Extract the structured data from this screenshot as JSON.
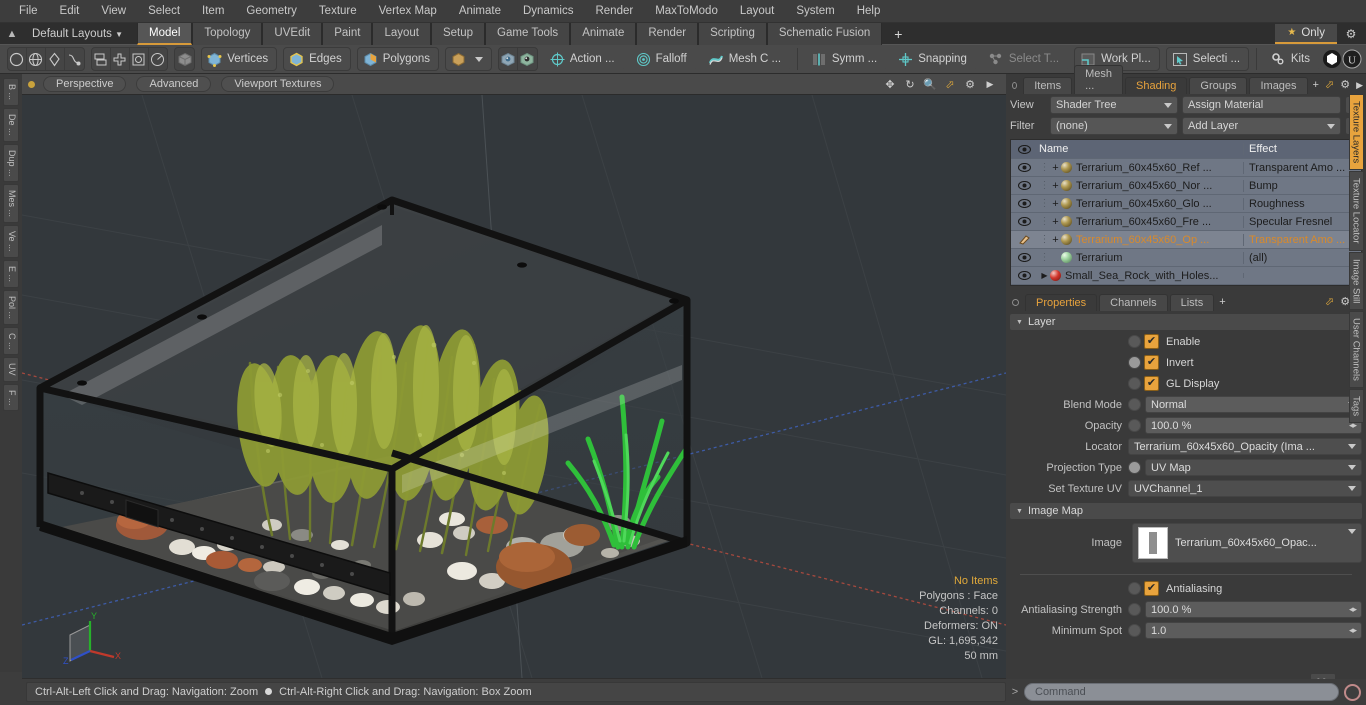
{
  "menubar": {
    "items": [
      "File",
      "Edit",
      "View",
      "Select",
      "Item",
      "Geometry",
      "Texture",
      "Vertex Map",
      "Animate",
      "Dynamics",
      "Render",
      "MaxToModo",
      "Layout",
      "System",
      "Help"
    ]
  },
  "layoutbar": {
    "default_layouts": "Default Layouts",
    "tabs": [
      "Model",
      "Topology",
      "UVEdit",
      "Paint",
      "Layout",
      "Setup",
      "Game Tools",
      "Animate",
      "Render",
      "Scripting",
      "Schematic Fusion"
    ],
    "active_tab": "Model",
    "add_tab": "+",
    "only_label": "Only"
  },
  "toolbar": {
    "mode_buttons": [
      "Vertices",
      "Edges",
      "Polygons"
    ],
    "action_label": "Action   ...",
    "falloff_label": "Falloff",
    "meshc_label": "Mesh C ...",
    "symm_label": "Symm ...",
    "snapping_label": "Snapping",
    "selectt_label": "Select T...",
    "workplane_label": "Work Pl...",
    "selection_label": "Selecti  ...",
    "kits_label": "Kits"
  },
  "left_rail": {
    "tabs": [
      "B ...",
      "De ...",
      "Dup ...",
      "Mes ...",
      "Ve ...",
      "E ...",
      "Pol ...",
      "C ...",
      "UV",
      "F ..."
    ]
  },
  "viewport": {
    "header": {
      "mode": "Perspective",
      "shading": "Advanced",
      "textures": "Viewport Textures"
    },
    "stats": {
      "items_label": "No Items",
      "polygons": "Polygons : Face",
      "channels": "Channels: 0",
      "deformers": "Deformers: ON",
      "gl": "GL: 1,695,342",
      "scale": "50 mm"
    },
    "axis": {
      "x": "X",
      "y": "Y",
      "z": "Z"
    }
  },
  "statusbar": {
    "left_hint": "Ctrl-Alt-Left Click and Drag: Navigation: Zoom",
    "right_hint": "Ctrl-Alt-Right Click and Drag: Navigation: Box Zoom"
  },
  "right_panel": {
    "tabs": [
      "Items",
      "Mesh ...",
      "Shading",
      "Groups",
      "Images"
    ],
    "active_tab": "Shading",
    "view_label": "View",
    "view_value": "Shader Tree",
    "assign_material": "Assign Material",
    "filter_label": "Filter",
    "filter_value": "(none)",
    "add_layer": "Add Layer",
    "tree_headers": {
      "name": "Name",
      "effect": "Effect"
    },
    "tree_rows": [
      {
        "name": "Terrarium_60x45x60_Ref ...",
        "effect": "Transparent Amo ...",
        "indent": 2,
        "sphere": "gold",
        "has_plus": true,
        "selected": false,
        "highlight": false,
        "has_caret": false
      },
      {
        "name": "Terrarium_60x45x60_Nor ...",
        "effect": "Bump",
        "indent": 2,
        "sphere": "gold",
        "has_plus": true,
        "selected": false,
        "highlight": false,
        "has_caret": true
      },
      {
        "name": "Terrarium_60x45x60_Glo ...",
        "effect": "Roughness",
        "indent": 2,
        "sphere": "gold",
        "has_plus": true,
        "selected": false,
        "highlight": false,
        "has_caret": true
      },
      {
        "name": "Terrarium_60x45x60_Fre ...",
        "effect": "Specular Fresnel",
        "indent": 2,
        "sphere": "gold",
        "has_plus": true,
        "selected": false,
        "highlight": false,
        "has_caret": true
      },
      {
        "name": "Terrarium_60x45x60_Op ...",
        "effect": "Transparent Amo ...",
        "indent": 2,
        "sphere": "gold",
        "has_plus": true,
        "selected": true,
        "highlight": true,
        "has_caret": false
      },
      {
        "name": "Terrarium",
        "effect": "(all)",
        "indent": 2,
        "sphere": "green",
        "has_plus": false,
        "selected": false,
        "highlight": false,
        "has_caret": true
      },
      {
        "name": "Small_Sea_Rock_with_Holes...",
        "effect": "",
        "indent": 1,
        "sphere": "red",
        "has_plus": false,
        "selected": false,
        "highlight": false,
        "has_caret": true
      }
    ],
    "prop_tabs": [
      "Properties",
      "Channels",
      "Lists"
    ],
    "prop_active_tab": "Properties",
    "prop_add": "+",
    "layer_section": "Layer",
    "enable_label": "Enable",
    "invert_label": "Invert",
    "gl_display_label": "GL Display",
    "blend_mode_label": "Blend Mode",
    "blend_mode_value": "Normal",
    "opacity_label": "Opacity",
    "opacity_value": "100.0 %",
    "locator_label": "Locator",
    "locator_value": "Terrarium_60x45x60_Opacity (Ima ...",
    "projection_label": "Projection Type",
    "projection_value": "UV Map",
    "set_texture_uv_label": "Set Texture UV",
    "set_texture_uv_value": "UVChannel_1",
    "image_map_section": "Image Map",
    "image_label": "Image",
    "image_value": "Terrarium_60x45x60_Opac...",
    "antialiasing_label": "Antialiasing",
    "aa_strength_label": "Antialiasing Strength",
    "aa_strength_value": "100.0 %",
    "min_spot_label": "Minimum Spot",
    "min_spot_value": "1.0",
    "go_button": ">>",
    "right_rail_tabs": [
      "Texture Layers",
      "Texture Locator",
      "Image Still",
      "User Channels",
      "Tags"
    ],
    "right_rail_active": "Texture Layers"
  },
  "command_bar": {
    "prompt": ">",
    "placeholder": "Command"
  },
  "colors": {
    "accent": "#e8a33d",
    "tree_bg": "#6f7785",
    "panel_bg": "#3a3a3a",
    "viewport_bg": "#33383c"
  }
}
